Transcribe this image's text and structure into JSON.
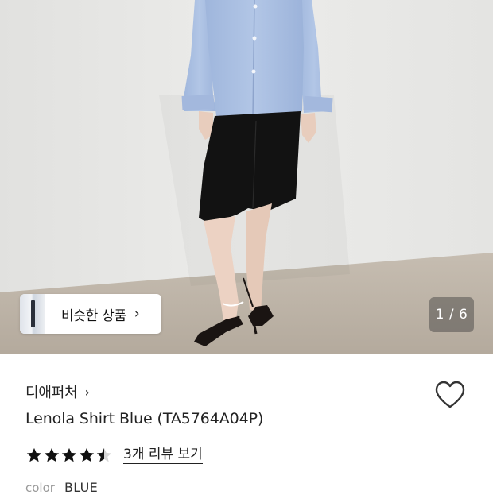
{
  "gallery": {
    "similar_label": "비슷한 상품",
    "similar_chevron": "›",
    "counter": "1 / 6"
  },
  "product": {
    "brand": "디애퍼처",
    "brand_chevron": "›",
    "title": "Lenola Shirt Blue (TA5764A04P)",
    "rating": 4.5,
    "review_link": "3개 리뷰 보기",
    "color_label": "color",
    "color_value": "BLUE",
    "wishlist_icon": "heart-outline-icon"
  },
  "colors": {
    "wall": "#e6e6e4",
    "floor": "#bdb3a6",
    "shirt": "#a9bedf",
    "shorts": "#111111",
    "star": "#111111"
  }
}
